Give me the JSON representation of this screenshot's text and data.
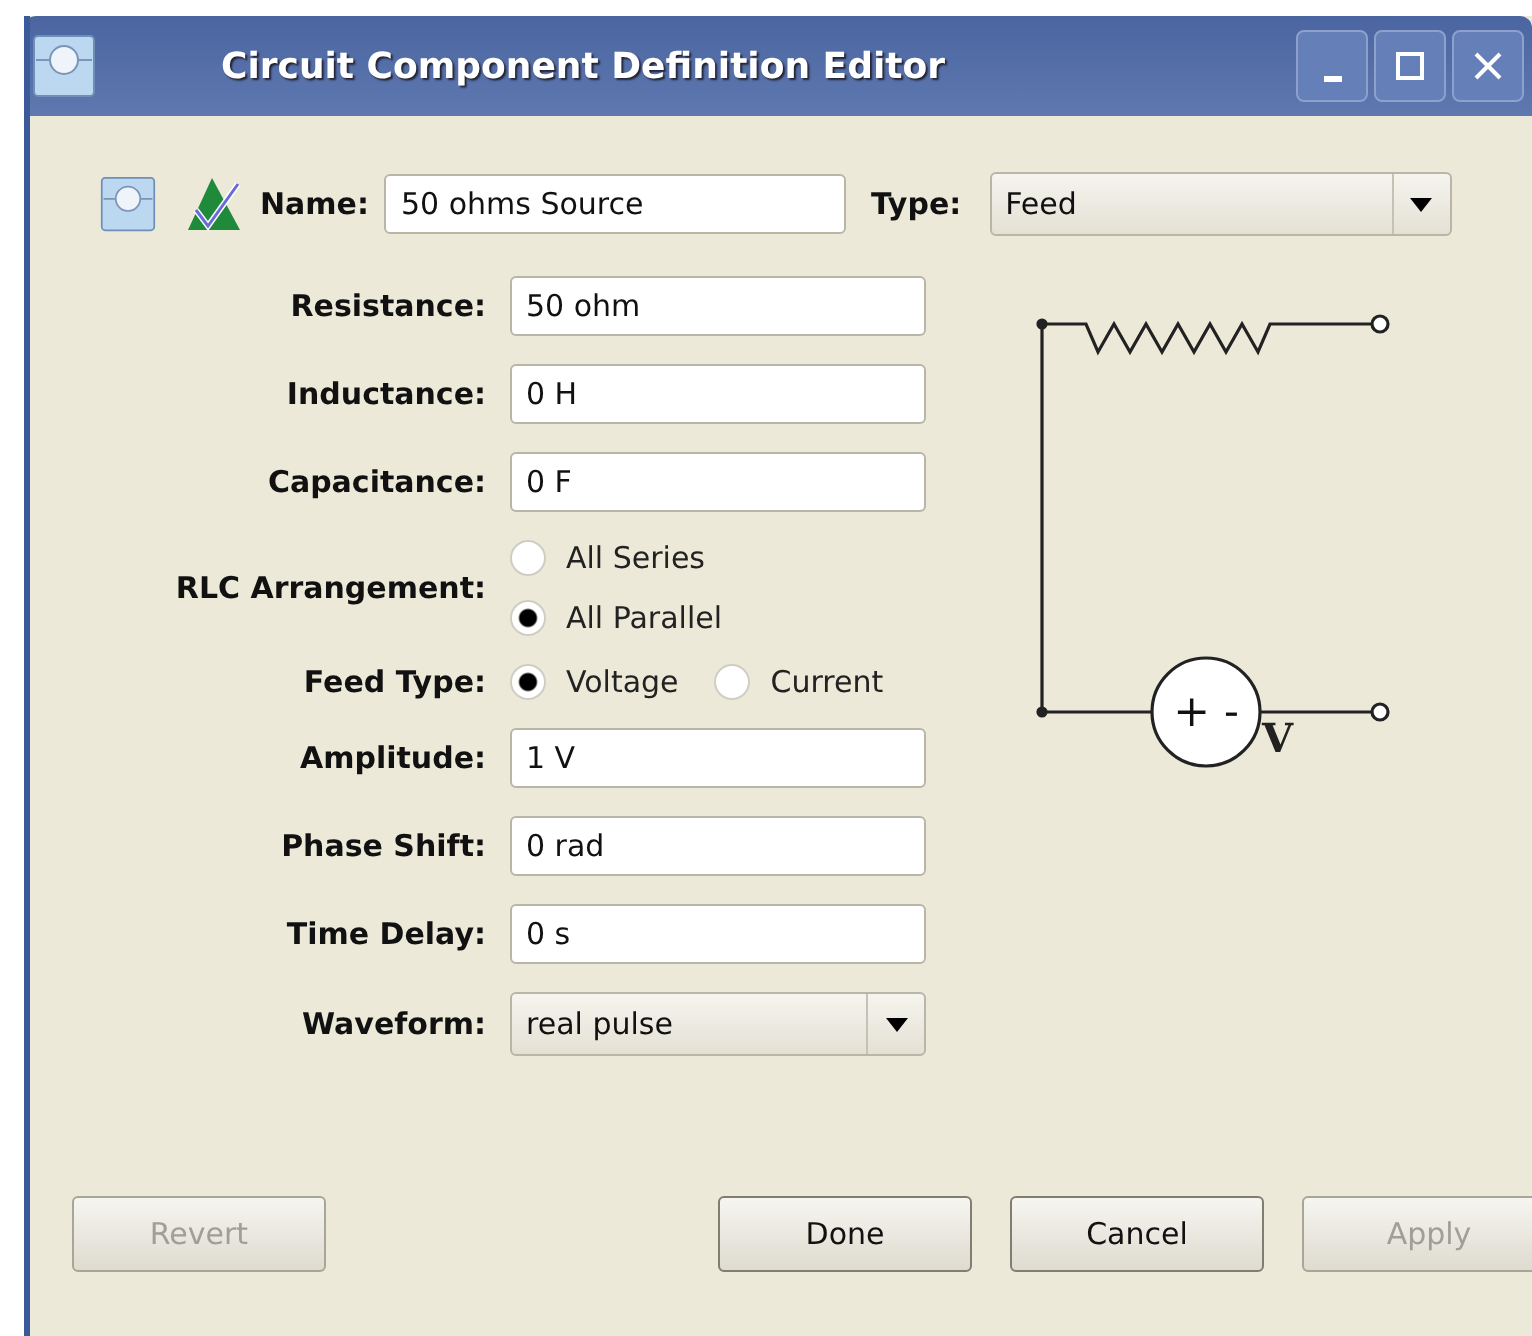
{
  "window": {
    "title": "Circuit Component Definition Editor"
  },
  "header": {
    "name_label": "Name:",
    "name_value": "50 ohms Source",
    "type_label": "Type:",
    "type_value": "Feed"
  },
  "fields": [
    {
      "kind": "text",
      "label": "Resistance:",
      "value": "50 ohm"
    },
    {
      "kind": "text",
      "label": "Inductance:",
      "value": "0 H"
    },
    {
      "kind": "text",
      "label": "Capacitance:",
      "value": "0 F"
    },
    {
      "kind": "radio_column",
      "label": "RLC Arrangement:",
      "options": [
        {
          "label": "All Series",
          "selected": false
        },
        {
          "label": "All Parallel",
          "selected": true
        }
      ]
    },
    {
      "kind": "radio_row",
      "label": "Feed Type:",
      "options": [
        {
          "label": "Voltage",
          "selected": true
        },
        {
          "label": "Current",
          "selected": false
        }
      ]
    },
    {
      "kind": "text",
      "label": "Amplitude:",
      "value": "1 V"
    },
    {
      "kind": "text",
      "label": "Phase Shift:",
      "value": "0 rad"
    },
    {
      "kind": "text",
      "label": "Time Delay:",
      "value": "0 s"
    },
    {
      "kind": "select",
      "label": "Waveform:",
      "value": "real pulse"
    }
  ],
  "diagram": {
    "polarity": "+ -",
    "source_label": "V"
  },
  "buttons": [
    {
      "label": "Revert",
      "disabled": true
    },
    {
      "label": "Done",
      "disabled": false
    },
    {
      "label": "Cancel",
      "disabled": false
    },
    {
      "label": "Apply",
      "disabled": true
    }
  ]
}
